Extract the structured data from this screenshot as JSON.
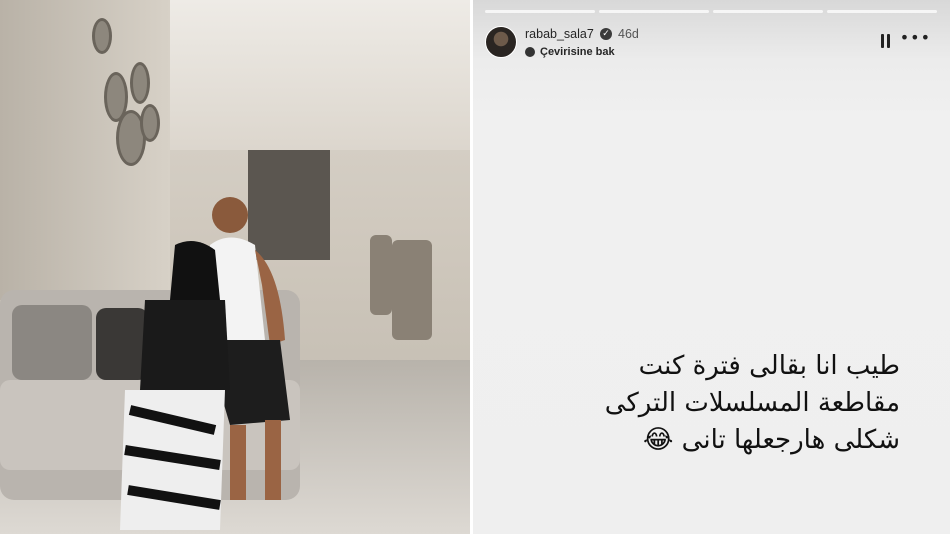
{
  "story": {
    "username": "rabab_sala7",
    "verified_icon": "verified-badge-icon",
    "age": "46d",
    "translate_label": "Çevirisine bak",
    "pause_icon": "pause-icon",
    "more_icon": "more-options-icon",
    "progress_segments": 4,
    "caption_lines": [
      "طيب انا بقالى فترة كنت",
      "مقاطعة المسلسلات التركى",
      "شكلى هارجعلها تانى 😂"
    ]
  },
  "photo": {
    "description_icon": "photo-image"
  }
}
